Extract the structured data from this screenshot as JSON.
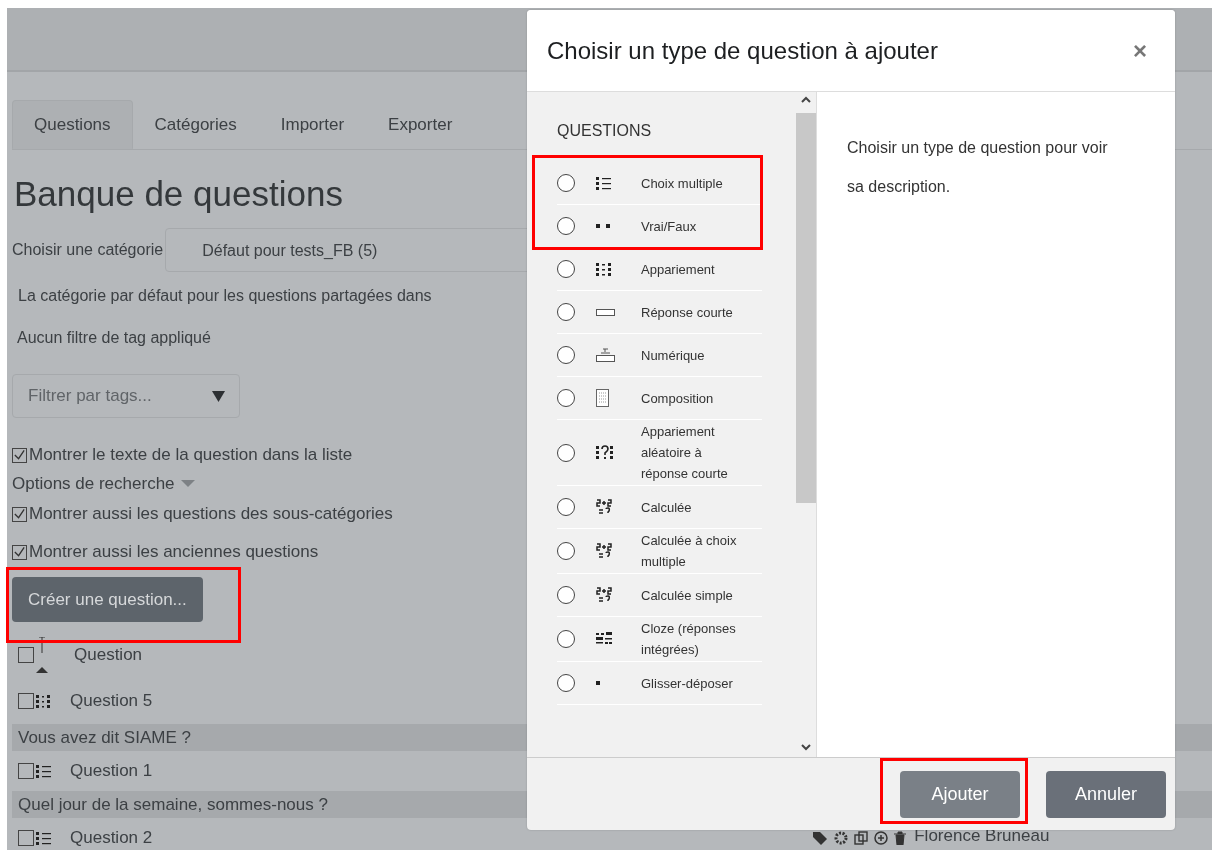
{
  "tabs": [
    {
      "label": "Questions",
      "selected": true
    },
    {
      "label": "Catégories",
      "selected": false
    },
    {
      "label": "Importer",
      "selected": false
    },
    {
      "label": "Exporter",
      "selected": false
    }
  ],
  "page_title": "Banque de questions",
  "category": {
    "label": "Choisir une catégorie",
    "value": "Défaut pour tests_FB (5)"
  },
  "category_description": "La catégorie par défaut pour les questions partagées dans",
  "tag_filter_status": "Aucun filtre de tag appliqué",
  "tag_filter": {
    "placeholder": "Filtrer par tags..."
  },
  "show_text": {
    "label": "Montrer le texte de la question dans la liste",
    "checked": true
  },
  "search_options": "Options de recherche",
  "search_checks": [
    {
      "label": "Montrer aussi les questions des sous-catégories",
      "checked": true
    },
    {
      "label": "Montrer aussi les anciennes questions",
      "checked": true
    }
  ],
  "create_button": "Créer une question...",
  "question_list": [
    {
      "kind": "header",
      "label": "Question",
      "checked": false
    },
    {
      "kind": "match",
      "label": "Question 5",
      "checked": false
    },
    {
      "kind": "text",
      "label": "Vous avez dit SIAME ?"
    },
    {
      "kind": "multichoice",
      "label": "Question 1",
      "checked": false
    },
    {
      "kind": "text",
      "label": "Quel jour de la semaine, sommes-nous ?"
    },
    {
      "kind": "multichoice",
      "label": "Question 2",
      "checked": false,
      "author": "Florence Bruneau"
    }
  ],
  "dialog": {
    "title": "Choisir un type de question à ajouter",
    "close": "×",
    "section": "QUESTIONS",
    "types": [
      {
        "kind": "multichoice",
        "label": "Choix multiple",
        "selected": false
      },
      {
        "kind": "truefalse",
        "label": "Vrai/Faux",
        "selected": false
      },
      {
        "kind": "match",
        "label": "Appariement",
        "selected": false
      },
      {
        "kind": "shortanswer",
        "label": "Réponse courte",
        "selected": false
      },
      {
        "kind": "numerical",
        "label": "Numérique",
        "selected": false
      },
      {
        "kind": "essay",
        "label": "Composition",
        "selected": false
      },
      {
        "kind": "randommatch",
        "label": "Appariement aléatoire à réponse courte",
        "selected": false
      },
      {
        "kind": "calculated",
        "label": "Calculée",
        "selected": false
      },
      {
        "kind": "calcmulti",
        "label": "Calculée à choix multiple",
        "selected": false
      },
      {
        "kind": "calcsimple",
        "label": "Calculée simple",
        "selected": false
      },
      {
        "kind": "cloze",
        "label": "Cloze (réponses intégrées)",
        "selected": false
      },
      {
        "kind": "dragdrop",
        "label": "Glisser-déposer",
        "selected": false
      }
    ],
    "description": "Choisir un type de question pour voir sa description.",
    "buttons": [
      {
        "label": "Ajouter",
        "kind": "primary"
      },
      {
        "label": "Annuler",
        "kind": "secondary"
      }
    ]
  }
}
